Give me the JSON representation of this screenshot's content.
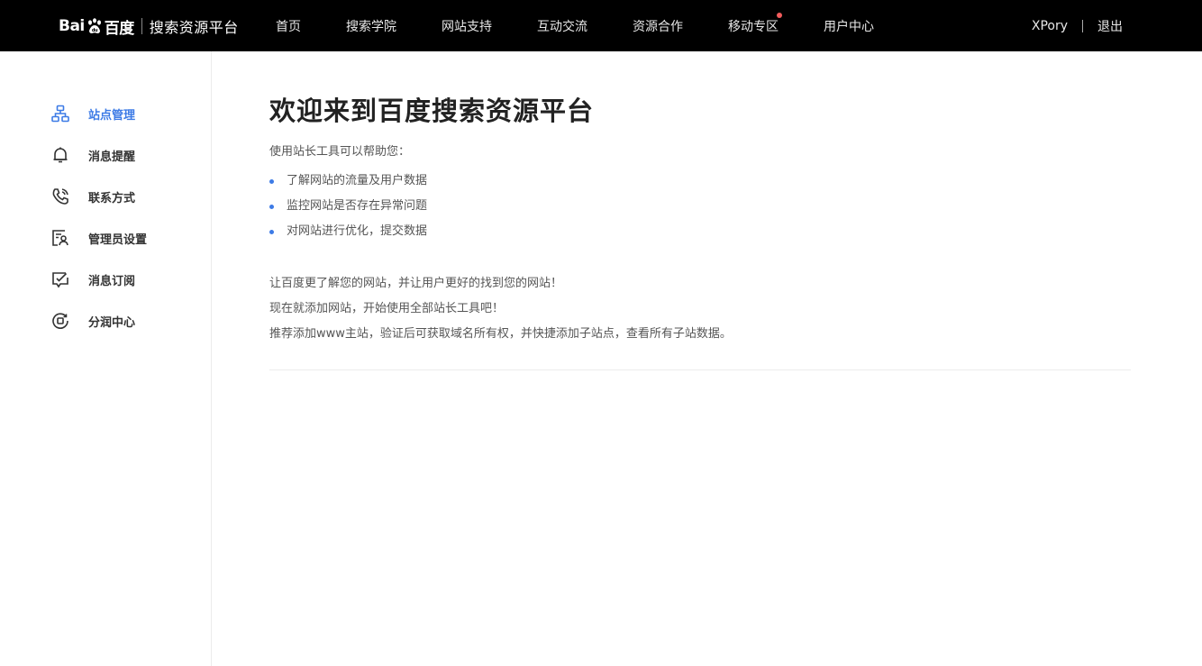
{
  "header": {
    "logo_text_left": "Bai",
    "logo_text_right": "百度",
    "logo_title": "搜索资源平台",
    "nav": [
      {
        "label": "首页",
        "dot": false
      },
      {
        "label": "搜索学院",
        "dot": false
      },
      {
        "label": "网站支持",
        "dot": false
      },
      {
        "label": "互动交流",
        "dot": false
      },
      {
        "label": "资源合作",
        "dot": false
      },
      {
        "label": "移动专区",
        "dot": true
      },
      {
        "label": "用户中心",
        "dot": false
      }
    ],
    "username": "XPory",
    "logout": "退出"
  },
  "sidebar": {
    "items": [
      {
        "label": "站点管理",
        "icon": "sitemap-icon",
        "active": true
      },
      {
        "label": "消息提醒",
        "icon": "bell-icon",
        "active": false
      },
      {
        "label": "联系方式",
        "icon": "phone-icon",
        "active": false
      },
      {
        "label": "管理员设置",
        "icon": "admin-icon",
        "active": false
      },
      {
        "label": "消息订阅",
        "icon": "subscribe-icon",
        "active": false
      },
      {
        "label": "分润中心",
        "icon": "revenue-icon",
        "active": false
      }
    ]
  },
  "main": {
    "title": "欢迎来到百度搜索资源平台",
    "intro": "使用站长工具可以帮助您：",
    "bullets": [
      "了解网站的流量及用户数据",
      "监控网站是否存在异常问题",
      "对网站进行优化，提交数据"
    ],
    "lines": [
      "让百度更了解您的网站，并让用户更好的找到您的网站！",
      "现在就添加网站，开始使用全部站长工具吧！",
      "推荐添加www主站，验证后可获取域名所有权，并快捷添加子站点，查看所有子站数据。"
    ]
  },
  "colors": {
    "header_bg": "#000000",
    "accent": "#3d7be6",
    "notify_dot": "#f25c5c"
  }
}
